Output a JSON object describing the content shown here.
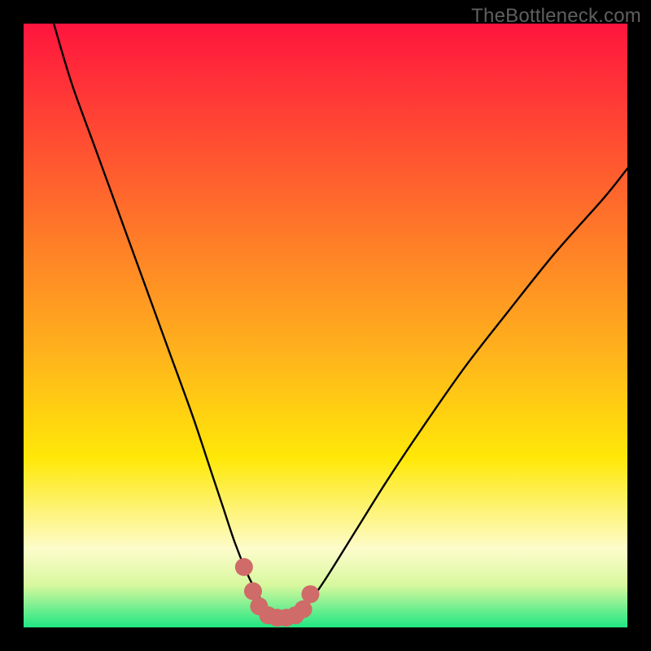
{
  "watermark": "TheBottleneck.com",
  "colors": {
    "frame": "#000000",
    "gradient_top": "#ff153e",
    "gradient_yellow": "#ffe808",
    "gradient_pale": "#fdfccb",
    "gradient_green": "#1fe783",
    "curve_stroke": "#000000",
    "marker_fill": "#cf6b68"
  },
  "chart_data": {
    "type": "line",
    "title": "",
    "xlabel": "",
    "ylabel": "",
    "xlim": [
      0,
      100
    ],
    "ylim": [
      0,
      100
    ],
    "annotations": [
      "TheBottleneck.com"
    ],
    "series": [
      {
        "name": "bottleneck-curve",
        "x": [
          5,
          8,
          12,
          16,
          20,
          24,
          28,
          31,
          33,
          35,
          37,
          38.5,
          40,
          41.5,
          43,
          44,
          45,
          47,
          50,
          55,
          60,
          66,
          73,
          80,
          88,
          96,
          100
        ],
        "y": [
          100,
          90,
          79,
          68,
          57,
          46,
          35,
          26,
          20,
          14,
          9,
          6,
          3.5,
          2.2,
          1.6,
          1.6,
          2.2,
          3.8,
          8,
          16,
          24,
          33,
          43,
          52,
          62,
          71,
          76
        ]
      }
    ],
    "markers": {
      "name": "valley-markers",
      "x": [
        36.5,
        38.0,
        39.0,
        40.5,
        42.0,
        43.5,
        45.0,
        46.3,
        47.5
      ],
      "y": [
        10.0,
        6.0,
        3.5,
        2.0,
        1.6,
        1.6,
        2.0,
        3.0,
        5.5
      ]
    }
  }
}
